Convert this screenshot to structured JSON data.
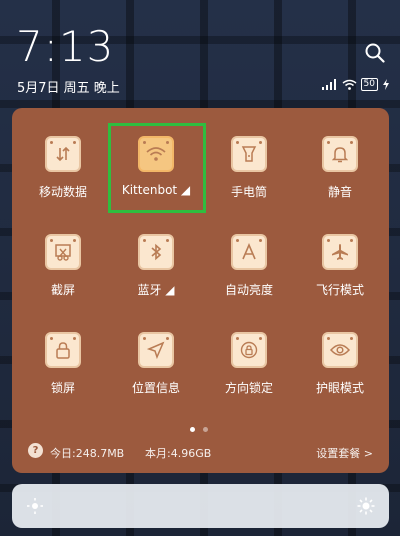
{
  "lockscreen": {
    "time": "7:13",
    "date": "5月7日 周五 晚上",
    "battery": "50"
  },
  "panel": {
    "tiles": [
      {
        "label": "移动数据",
        "icon": "mobile-data-icon"
      },
      {
        "label": "Kittenbot ◢",
        "icon": "wifi-icon"
      },
      {
        "label": "手电筒",
        "icon": "flashlight-icon"
      },
      {
        "label": "静音",
        "icon": "bell-icon"
      },
      {
        "label": "截屏",
        "icon": "screenshot-icon"
      },
      {
        "label": "蓝牙 ◢",
        "icon": "bluetooth-icon"
      },
      {
        "label": "自动亮度",
        "icon": "auto-brightness-icon"
      },
      {
        "label": "飞行模式",
        "icon": "airplane-icon"
      },
      {
        "label": "锁屏",
        "icon": "lock-icon"
      },
      {
        "label": "位置信息",
        "icon": "location-icon"
      },
      {
        "label": "方向锁定",
        "icon": "rotation-lock-icon"
      },
      {
        "label": "护眼模式",
        "icon": "eye-icon"
      }
    ],
    "data_usage": {
      "help": "?",
      "today": "今日:248.7MB",
      "month": "本月:4.96GB",
      "settings": "设置套餐 >"
    }
  },
  "colors": {
    "panel": "#9c5a3e",
    "tile_bg": "#fbe7cf",
    "tile_active": "#f5c681",
    "highlight": "#2fbe3f"
  }
}
